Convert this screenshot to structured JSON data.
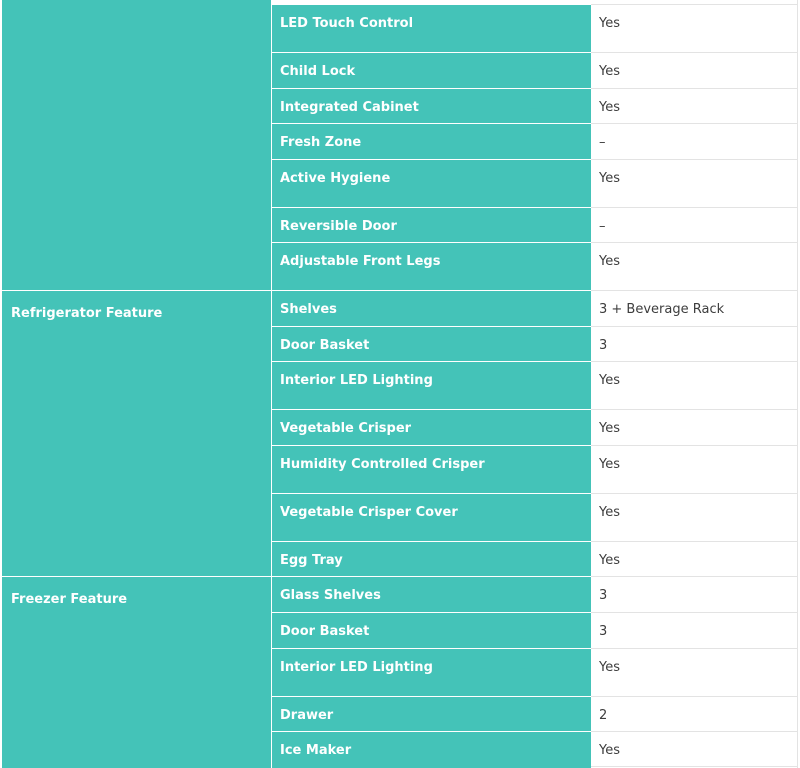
{
  "table": {
    "groups": [
      {
        "category": "",
        "rows": [
          {
            "feature": "LED Touch Control",
            "value": "Yes"
          },
          {
            "feature": "Child Lock",
            "value": "Yes"
          },
          {
            "feature": "Integrated Cabinet",
            "value": "Yes"
          },
          {
            "feature": "Fresh Zone",
            "value": "–"
          },
          {
            "feature": "Active Hygiene",
            "value": "Yes"
          },
          {
            "feature": "Reversible Door",
            "value": "–"
          },
          {
            "feature": "Adjustable Front Legs",
            "value": "Yes"
          }
        ]
      },
      {
        "category": "Refrigerator Feature",
        "rows": [
          {
            "feature": "Shelves",
            "value": "3 + Beverage Rack"
          },
          {
            "feature": "Door Basket",
            "value": "3"
          },
          {
            "feature": "Interior LED Lighting",
            "value": "Yes"
          },
          {
            "feature": "Vegetable Crisper",
            "value": "Yes"
          },
          {
            "feature": "Humidity Controlled Crisper",
            "value": "Yes"
          },
          {
            "feature": "Vegetable Crisper Cover",
            "value": "Yes"
          },
          {
            "feature": "Egg Tray",
            "value": "Yes"
          }
        ]
      },
      {
        "category": "Freezer Feature",
        "rows": [
          {
            "feature": "Glass Shelves",
            "value": "3"
          },
          {
            "feature": "Door Basket",
            "value": "3"
          },
          {
            "feature": "Interior LED Lighting",
            "value": "Yes"
          },
          {
            "feature": "Drawer",
            "value": "2"
          },
          {
            "feature": "Ice Maker",
            "value": "Yes"
          }
        ]
      }
    ]
  },
  "colors": {
    "accent": "#44c3b8",
    "value_background": "#ffffff",
    "value_text": "#3d3d3d",
    "border": "#e3e3e3"
  }
}
